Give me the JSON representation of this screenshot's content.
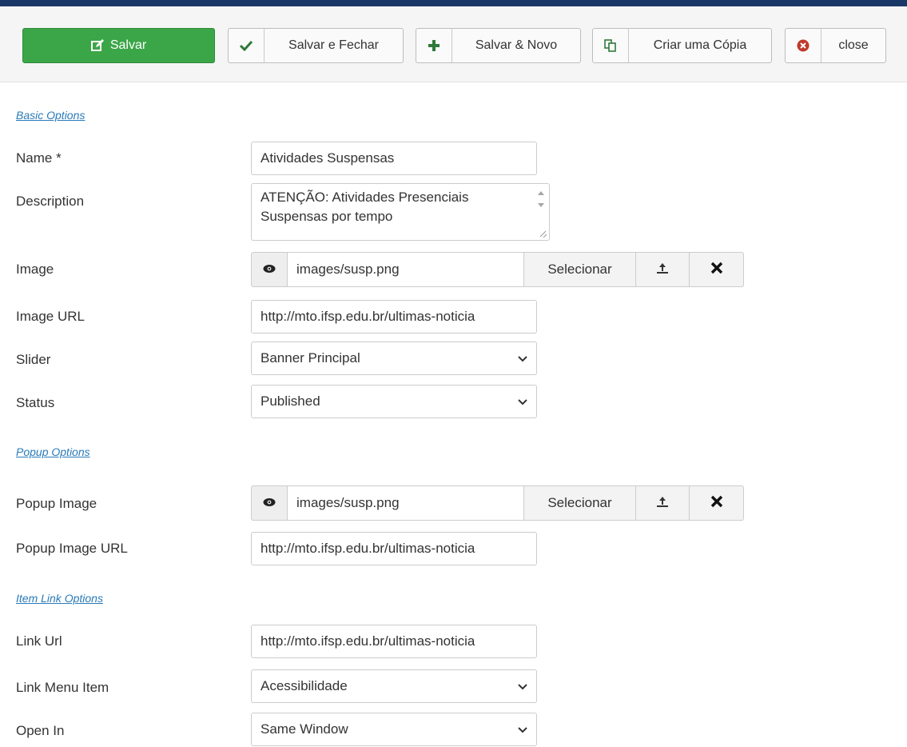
{
  "toolbar": {
    "save_label": "Salvar",
    "save_close_label": "Salvar e Fechar",
    "save_new_label": "Salvar & Novo",
    "copy_label": "Criar uma Cópia",
    "close_label": "close"
  },
  "sections": {
    "basic": "Basic Options",
    "popup": "Popup Options",
    "link": "Item Link Options"
  },
  "fields": {
    "name": {
      "label": "Name *",
      "value": "Atividades Suspensas"
    },
    "description": {
      "label": "Description",
      "value": "ATENÇÃO: Atividades Presenciais Suspensas por tempo"
    },
    "image": {
      "label": "Image",
      "value": "images/susp.png",
      "select_label": "Selecionar"
    },
    "image_url": {
      "label": "Image URL",
      "value": "http://mto.ifsp.edu.br/ultimas-noticia"
    },
    "slider": {
      "label": "Slider",
      "value": "Banner Principal"
    },
    "status": {
      "label": "Status",
      "value": "Published"
    },
    "popup_image": {
      "label": "Popup Image",
      "value": "images/susp.png",
      "select_label": "Selecionar"
    },
    "popup_image_url": {
      "label": "Popup Image URL",
      "value": "http://mto.ifsp.edu.br/ultimas-noticia"
    },
    "link_url": {
      "label": "Link Url",
      "value": "http://mto.ifsp.edu.br/ultimas-noticia"
    },
    "link_menu_item": {
      "label": "Link Menu Item",
      "value": "Acessibilidade"
    },
    "open_in": {
      "label": "Open In",
      "value": "Same Window"
    }
  },
  "colors": {
    "accent_bar": "#1a3867",
    "save_green": "#3ba648",
    "section_link": "#2a7ab8",
    "close_red": "#c0392b"
  }
}
